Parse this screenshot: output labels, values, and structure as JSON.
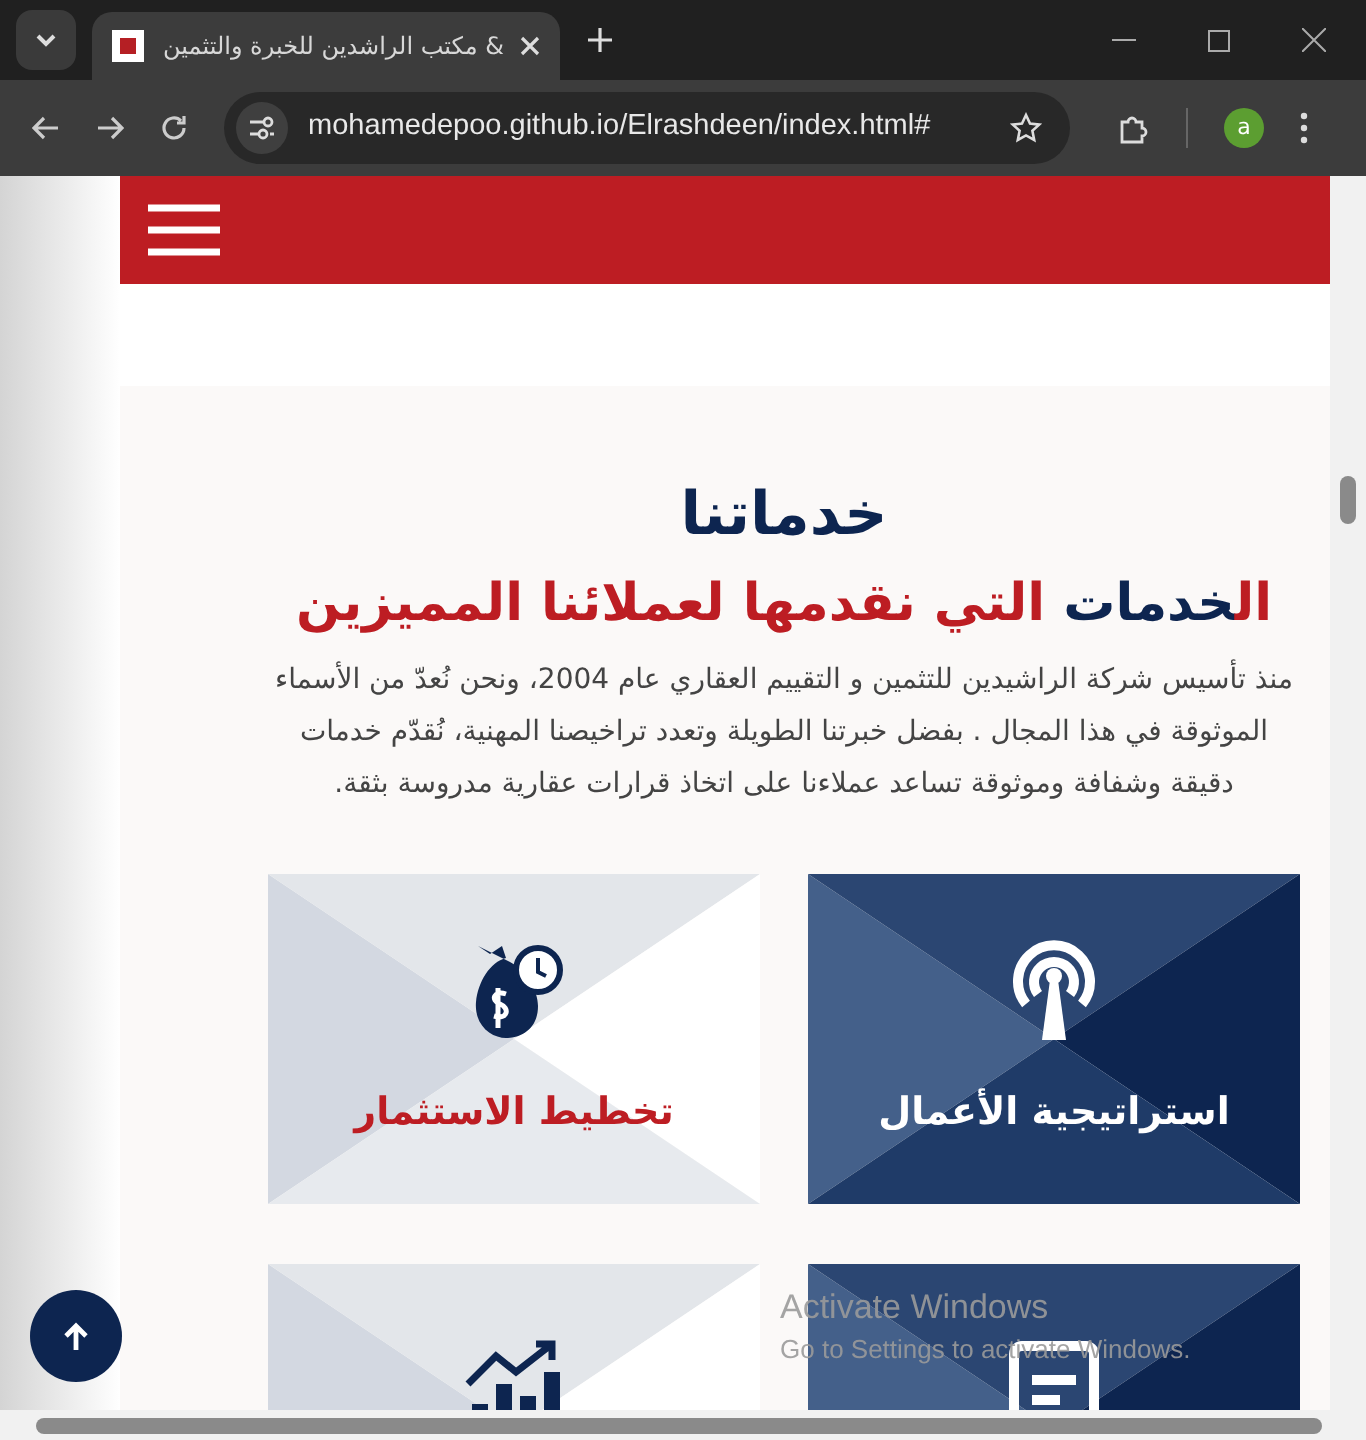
{
  "browser": {
    "tab": {
      "title": "مكتب الراشدين للخبرة والتثمين &",
      "selected": true
    },
    "url": "mohamedepoo.github.io/Elrashdeen/index.html#",
    "profile_initial": "a"
  },
  "services": {
    "heading": "خدماتنا",
    "subheading": [
      {
        "text": "ال",
        "color": "#bd1d23"
      },
      {
        "text": "خدمات",
        "color": "#0d2550"
      },
      {
        "text": " التي نقدمها لعملائنا المميزين",
        "color": "#bd1d23"
      }
    ],
    "description": "منذ تأسيس شركة الراشيدين للتثمين و التقييم العقاري عام 2004، ونحن نُعدّ من الأسماء الموثوقة في هذا المجال . بفضل خبرتنا الطويلة وتعدد تراخيصنا المهنية، نُقدّم خدمات دقيقة وشفافة وموثوقة تساعد عملاءنا على اتخاذ قرارات عقارية مدروسة بثقة.",
    "cards": [
      {
        "kind": "dark",
        "title": "استراتيجية الأعمال"
      },
      {
        "kind": "light",
        "title": "تخطيط الاستثمار"
      },
      {
        "kind": "dark"
      },
      {
        "kind": "light"
      }
    ]
  },
  "os_notice": {
    "title": "Activate Windows",
    "text": "Go to Settings to activate Windows."
  }
}
